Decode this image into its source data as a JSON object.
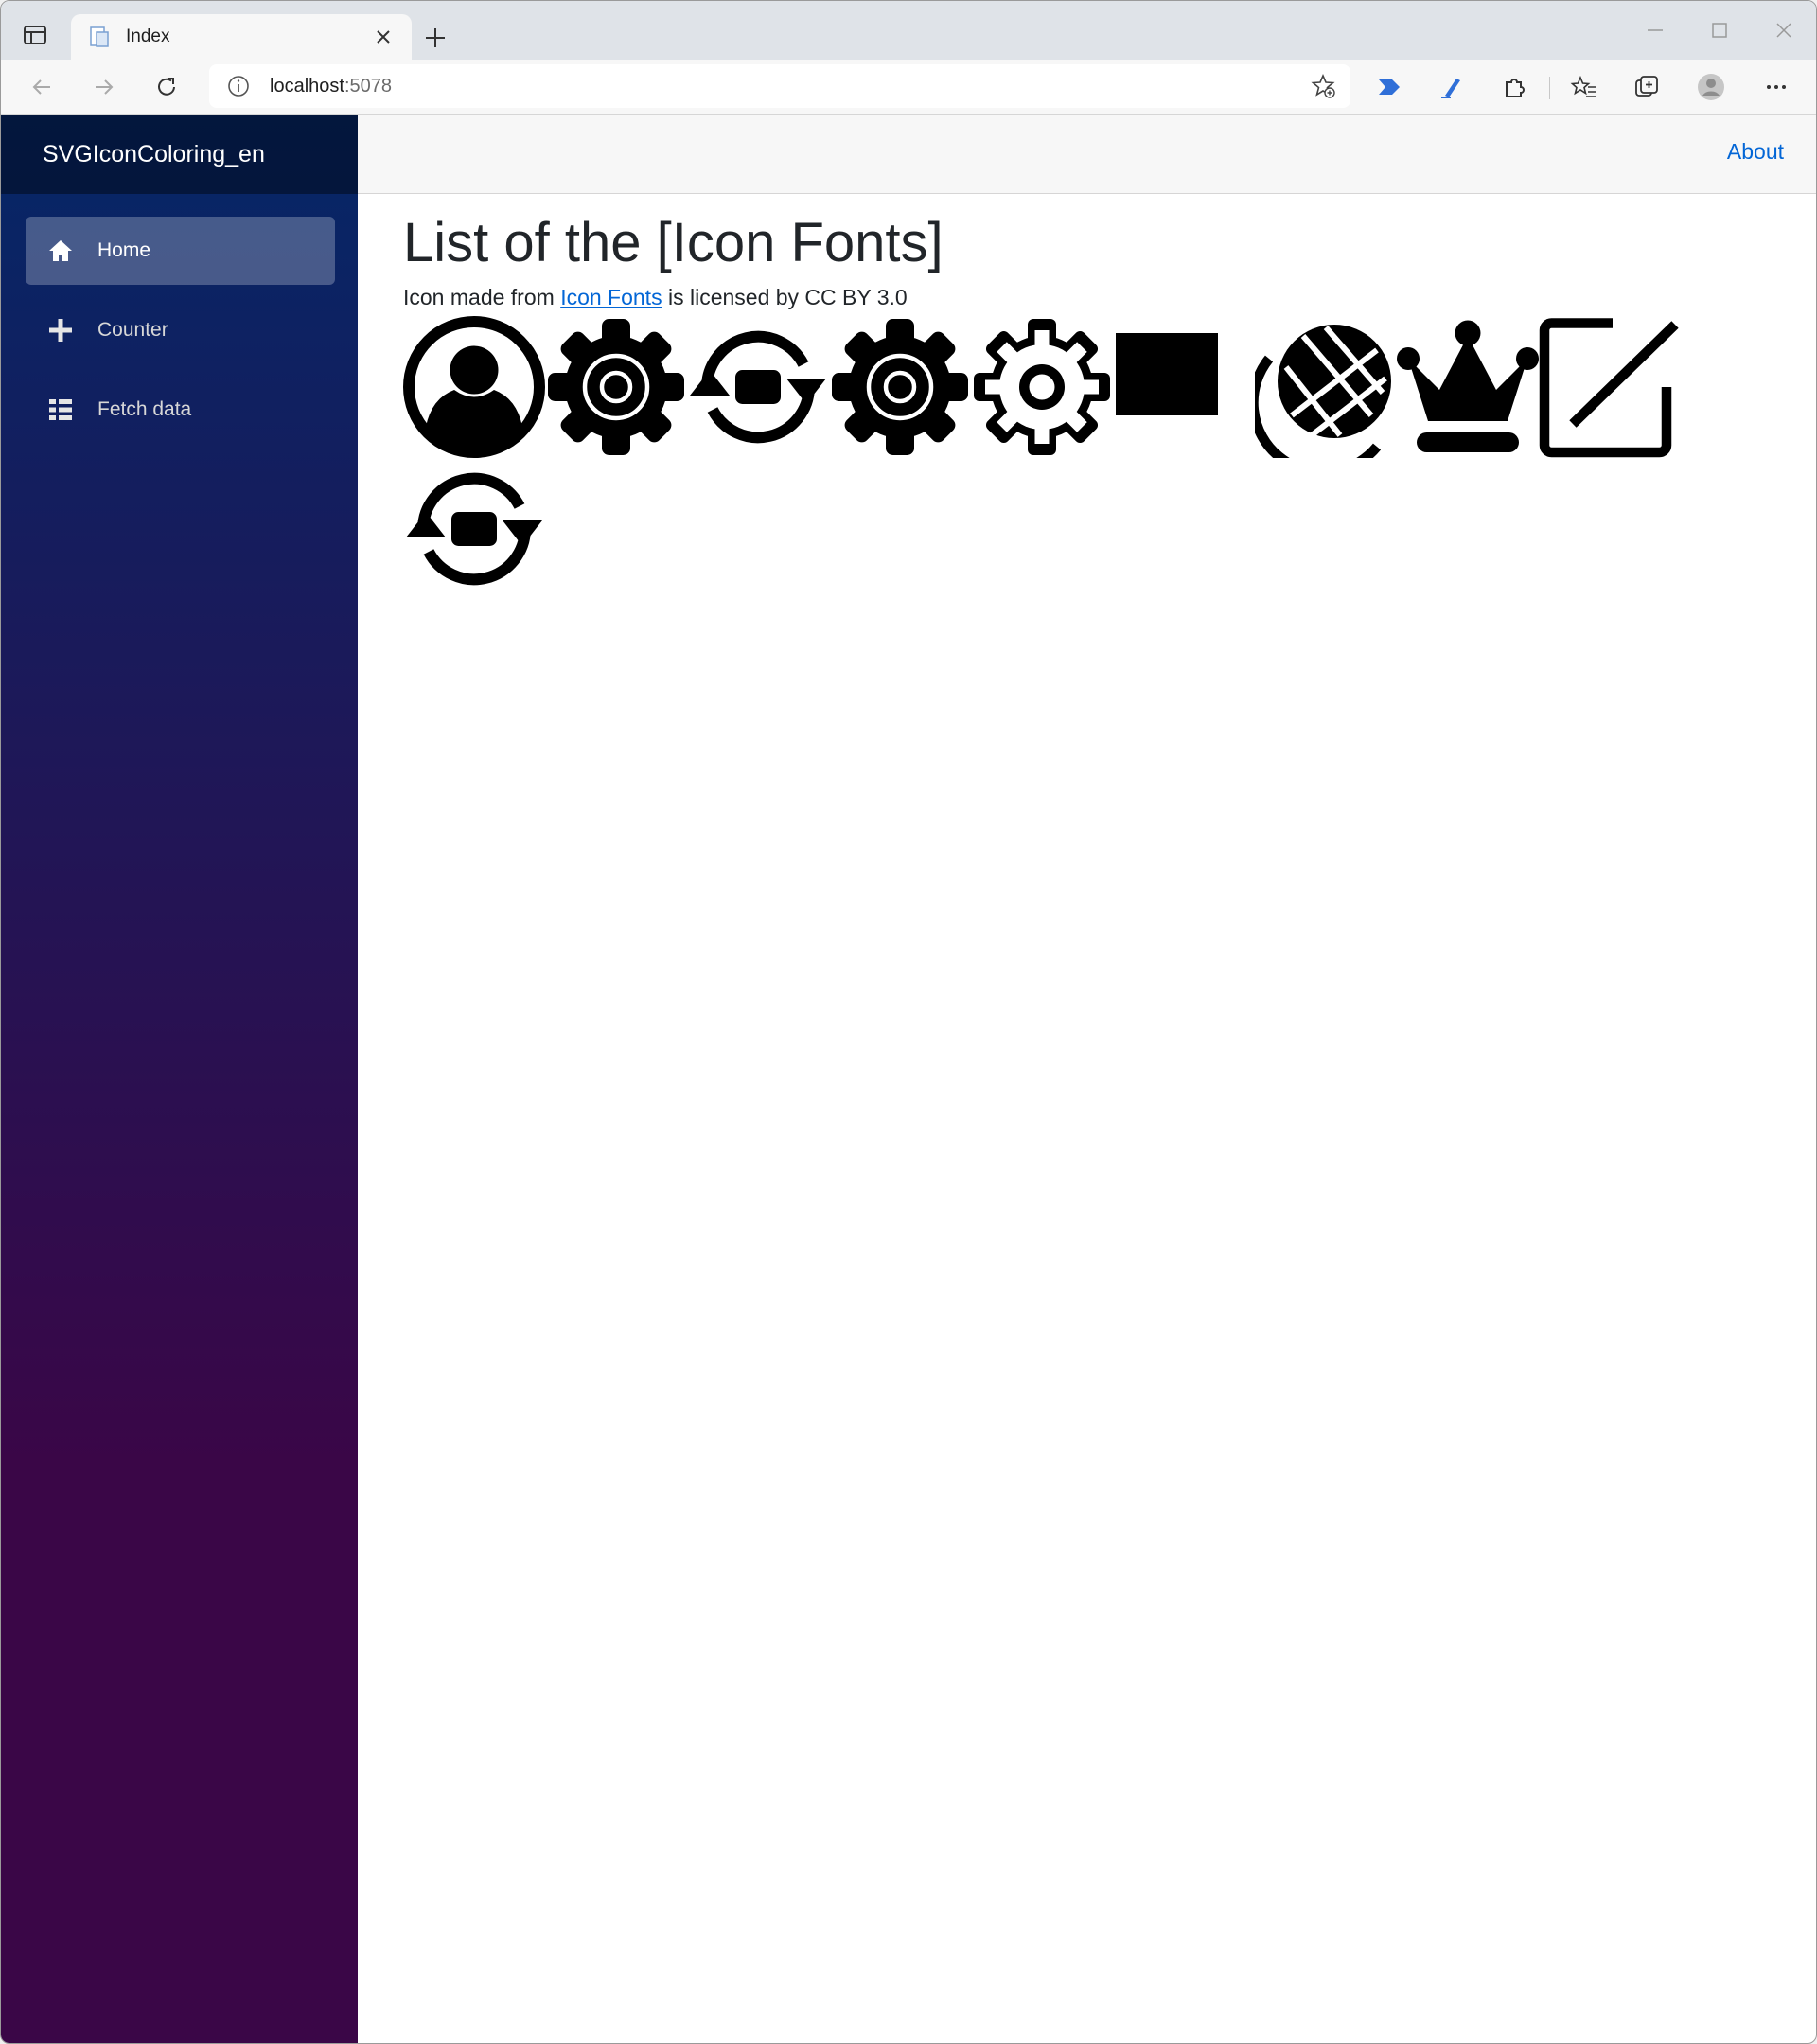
{
  "browser": {
    "tab": {
      "title": "Index"
    },
    "address": {
      "host": "localhost",
      "port": ":5078"
    }
  },
  "app": {
    "brand": "SVGIconColoring_en",
    "nav": [
      {
        "label": "Home",
        "icon": "home-icon",
        "active": true
      },
      {
        "label": "Counter",
        "icon": "plus-icon",
        "active": false
      },
      {
        "label": "Fetch data",
        "icon": "list-icon",
        "active": false
      }
    ],
    "top_link": "About"
  },
  "main": {
    "heading": "List of the [Icon Fonts]",
    "credit_prefix": "Icon made from ",
    "credit_link": "Icon Fonts",
    "credit_suffix": " is licensed by CC BY 3.0",
    "icons": [
      "user-icon",
      "gear-icon",
      "sync-icon",
      "gear-icon",
      "gear-outline-icon",
      "square-icon",
      "globe-icon",
      "crown-icon",
      "edit-icon",
      "sync-icon"
    ]
  },
  "colors": {
    "link": "#0366d6",
    "sidebar_top": "#052767",
    "sidebar_bottom": "#3a0647"
  }
}
